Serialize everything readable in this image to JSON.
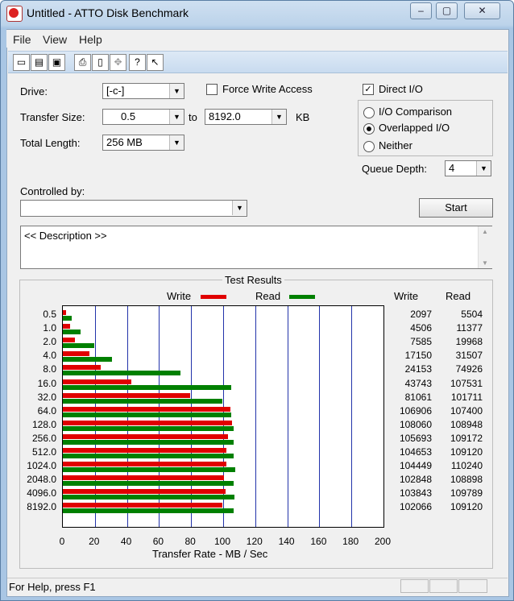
{
  "window": {
    "title": "Untitled - ATTO Disk Benchmark",
    "minimize": "–",
    "maximize": "▢",
    "close": "✕"
  },
  "menu": [
    "File",
    "View",
    "Help"
  ],
  "toolbar": [
    "new-icon",
    "open-icon",
    "save-icon",
    "print-icon",
    "print-preview-icon",
    "move-icon",
    "help-icon",
    "context-help-icon"
  ],
  "form": {
    "drive_label": "Drive:",
    "drive_value": "[-c-]",
    "transfer_size_label": "Transfer Size:",
    "transfer_from": "0.5",
    "to_label": "to",
    "transfer_to": "8192.0",
    "kb_label": "KB",
    "total_length_label": "Total Length:",
    "total_length_value": "256 MB",
    "force_write_label": "Force Write Access",
    "direct_io_label": "Direct I/O",
    "io_comparison_label": "I/O Comparison",
    "overlapped_io_label": "Overlapped I/O",
    "neither_label": "Neither",
    "queue_depth_label": "Queue Depth:",
    "queue_depth_value": "4",
    "controlled_by_label": "Controlled by:",
    "controlled_by_value": "",
    "start_label": "Start",
    "description": "<< Description >>",
    "direct_io_checked": "✓"
  },
  "results": {
    "title": "Test Results",
    "legend_write": "Write",
    "legend_read": "Read",
    "col_write": "Write",
    "col_read": "Read",
    "xlabel": "Transfer Rate - MB / Sec"
  },
  "colors": {
    "write": "#e00000",
    "read": "#008000",
    "grid": "#2233aa"
  },
  "chart_data": {
    "type": "bar",
    "orientation": "horizontal",
    "categories": [
      "0.5",
      "1.0",
      "2.0",
      "4.0",
      "8.0",
      "16.0",
      "32.0",
      "64.0",
      "128.0",
      "256.0",
      "512.0",
      "1024.0",
      "2048.0",
      "4096.0",
      "8192.0"
    ],
    "series": [
      {
        "name": "Write",
        "values": [
          2097,
          4506,
          7585,
          17150,
          24153,
          43743,
          81061,
          106906,
          108060,
          105693,
          104653,
          104449,
          102848,
          103843,
          102066
        ]
      },
      {
        "name": "Read",
        "values": [
          5504,
          11377,
          19968,
          31507,
          74926,
          107531,
          101711,
          107400,
          108948,
          109172,
          109120,
          110240,
          108898,
          109789,
          109120
        ]
      }
    ],
    "xticks": [
      "0",
      "20",
      "40",
      "60",
      "80",
      "100",
      "120",
      "140",
      "160",
      "180",
      "200"
    ],
    "xlim": [
      0,
      200
    ],
    "xlabel": "Transfer Rate - MB / Sec",
    "legend": "top"
  },
  "status": {
    "help_text": "For Help, press F1"
  }
}
